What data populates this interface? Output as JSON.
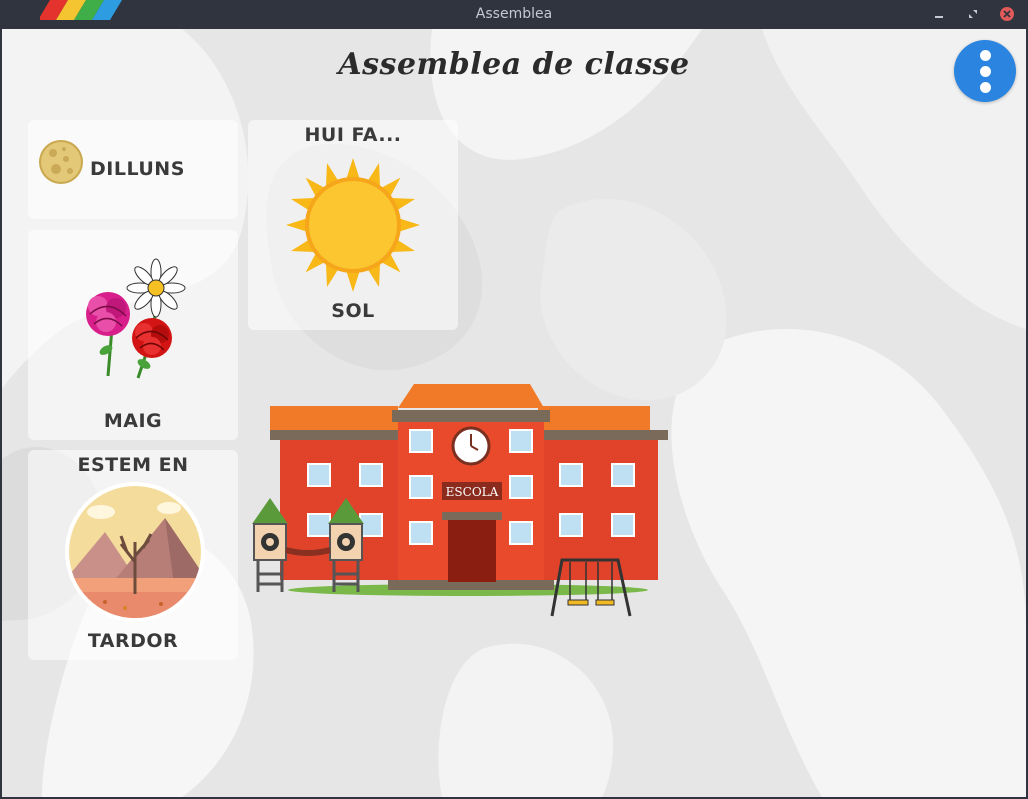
{
  "window": {
    "title": "Assemblea"
  },
  "app": {
    "title": "Assemblea de classe"
  },
  "day": {
    "label": "DILLUNS",
    "icon": "moon-icon"
  },
  "month": {
    "label": "MAIG",
    "icon": "flowers-icon"
  },
  "season": {
    "heading": "ESTEM EN",
    "label": "TARDOR",
    "icon": "autumn-landscape-icon"
  },
  "weather": {
    "heading": "HUI FA...",
    "label": "SOL",
    "icon": "sun-icon"
  },
  "school": {
    "sign": "ESCOLA"
  },
  "colors": {
    "accent": "#2a84e0",
    "titlebar": "#2f343f",
    "close": "#e05a5a"
  }
}
